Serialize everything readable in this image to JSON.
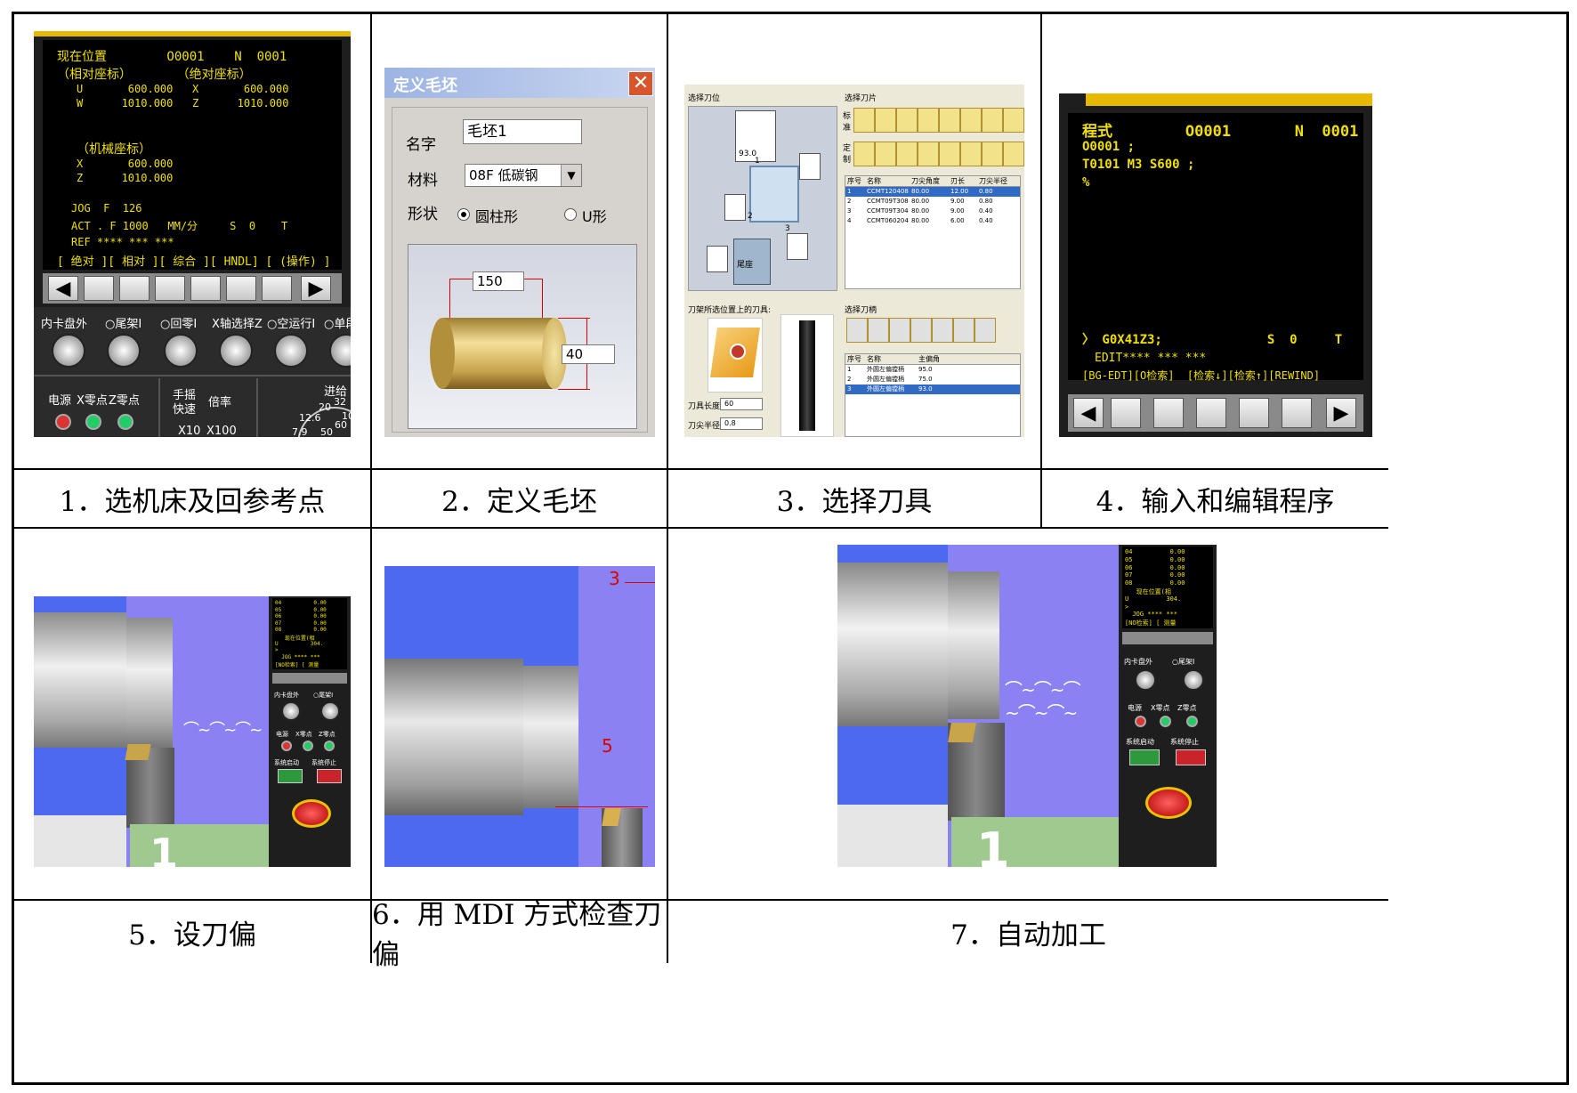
{
  "captions": {
    "c1": "1．选机床及回参考点",
    "c2": "2．定义毛坯",
    "c3": "3．选择刀具",
    "c4": "4．输入和编辑程序",
    "c5": "5．设刀偏",
    "c6": "6．用 MDI 方式检查刀偏",
    "c7": "7．自动加工"
  },
  "panel1": {
    "lines": [
      "现在位置        O0001    N  0001",
      "（相对座标）      （绝对座标）",
      "U       600.000   X       600.000",
      "W      1010.000   Z      1010.000",
      "",
      "（机械座标）",
      "X       600.000",
      "Z      1010.000",
      "",
      "JOG  F  126",
      "ACT . F 1000   MM/分     S  0    T",
      "REF **** *** ***",
      "[ 绝对 ][ 相对 ][ 综合 ][ HNDL] [ (操作) ]"
    ],
    "knob_labels": [
      "内卡盘外",
      "○尾架Ⅰ",
      "○回零Ⅰ",
      "X轴选择Z",
      "○空运行Ⅰ",
      "○单段"
    ],
    "led_labels": [
      "电源",
      "X零点",
      "Z零点"
    ],
    "mode_labels": [
      "手摇",
      "快速",
      "倍率"
    ],
    "rate_labels": [
      "X10",
      "X100"
    ],
    "feed_label": "进给",
    "dial_ticks": [
      "20",
      "32",
      "12.6",
      "50",
      "60",
      "7.9",
      "10"
    ]
  },
  "panel2": {
    "title": "定义毛坯",
    "name_label": "名字",
    "name_value": "毛坯1",
    "material_label": "材料",
    "material_value": "08F 低碳钢",
    "shape_label": "形状",
    "shape_opt1": "圆柱形",
    "shape_opt2": "U形",
    "length": "150",
    "diameter": "40"
  },
  "panel3": {
    "left_title": "选择刀位",
    "insert_title": "选择刀片",
    "std_label": "标准",
    "custom_label": "定制",
    "insert_columns": [
      "序号",
      "名称",
      "刀尖角度",
      "刃长",
      "刀尖半径"
    ],
    "inserts": [
      [
        "1",
        "CCMT120408",
        "80.00",
        "12.00",
        "0.80"
      ],
      [
        "2",
        "CCMT09T308",
        "80.00",
        "9.00",
        "0.80"
      ],
      [
        "3",
        "CCMT09T304",
        "80.00",
        "9.00",
        "0.40"
      ],
      [
        "4",
        "CCMT060204",
        "80.00",
        "6.00",
        "0.40"
      ]
    ],
    "holder_pos_title": "刀架所选位置上的刀具:",
    "holder_title": "选择刀柄",
    "holder_columns": [
      "序号",
      "名称",
      "主偏角"
    ],
    "holders": [
      [
        "1",
        "外圆左偏镗柄",
        "95.0"
      ],
      [
        "2",
        "外圆左偏镗柄",
        "75.0"
      ],
      [
        "3",
        "外圆左偏镗柄",
        "93.0"
      ]
    ],
    "tool_length_label": "刀具长度",
    "tool_length": "60",
    "tip_radius_label": "刀尖半径",
    "tip_radius": "0.8",
    "turret_labels": [
      "1",
      "2",
      "3"
    ],
    "tail_label": "尾座",
    "angle_value": "93.0"
  },
  "panel4": {
    "lines": [
      "程式        O0001       N  0001",
      "O0001 ;",
      "T0101 M3 S600 ;",
      "%"
    ],
    "input_line": "〉 G0X41Z3;              S  0     T",
    "status_line": "EDIT**** *** ***",
    "softkeys": "[BG-EDT][O检索]  [检索↓][检索↑][REWIND]"
  },
  "panel5": {
    "scr_lines": [
      "04          0.00",
      "05          0.00",
      "06          0.00",
      "07          0.00",
      "08          0.00",
      "   现在位置(相",
      "U          304.",
      ">",
      "  JOG **** ***",
      "[NO检索] [ 测量"
    ],
    "knob_labels": [
      "内卡盘外",
      "○尾架Ⅰ"
    ],
    "led_labels": [
      "电源",
      "X零点",
      "Z零点"
    ],
    "sys_labels": [
      "系统启动",
      "系统停止"
    ],
    "floor_digit": "1"
  },
  "panel6": {
    "mark_top": "3",
    "mark_mid": "5"
  },
  "colors": {
    "screen_text": "#f0e000",
    "scene_blue": "#4d69f0",
    "scene_violet": "#8a82f2",
    "floor_green": "#9fc98f"
  }
}
